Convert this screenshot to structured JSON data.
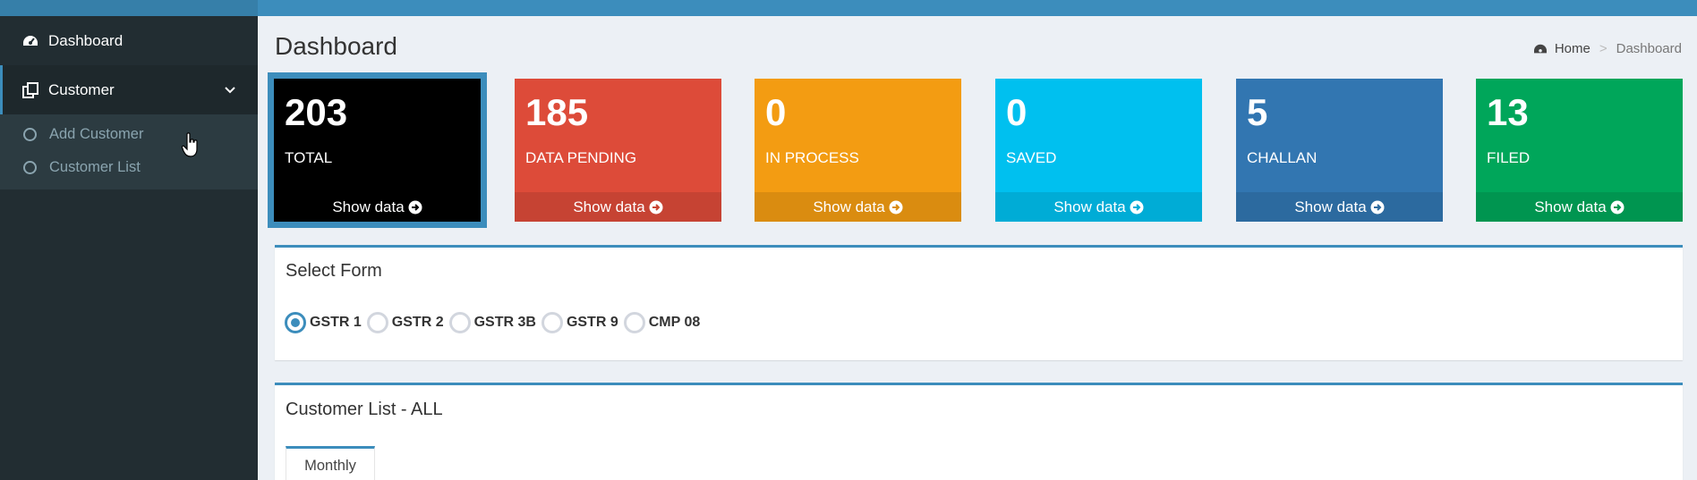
{
  "sidebar": {
    "items": [
      {
        "label": "Dashboard",
        "icon": "dashboard-icon"
      },
      {
        "label": "Customer",
        "icon": "customer-icon",
        "expanded": true,
        "children": [
          {
            "label": "Add Customer"
          },
          {
            "label": "Customer List"
          }
        ]
      }
    ]
  },
  "header": {
    "title": "Dashboard",
    "breadcrumb": {
      "home": "Home",
      "separator": ">",
      "current": "Dashboard"
    }
  },
  "stats": [
    {
      "value": "203",
      "label": "TOTAL",
      "link": "Show data",
      "color": "#000000",
      "selected": true
    },
    {
      "value": "185",
      "label": "DATA PENDING",
      "link": "Show data",
      "color": "#dd4b39"
    },
    {
      "value": "0",
      "label": "IN PROCESS",
      "link": "Show data",
      "color": "#f39c12"
    },
    {
      "value": "0",
      "label": "SAVED",
      "link": "Show data",
      "color": "#00c0ef"
    },
    {
      "value": "5",
      "label": "CHALLAN",
      "link": "Show data",
      "color": "#3276b1"
    },
    {
      "value": "13",
      "label": "FILED",
      "link": "Show data",
      "color": "#00a65a"
    }
  ],
  "select_form": {
    "title": "Select Form",
    "options": [
      "GSTR 1",
      "GSTR 2",
      "GSTR 3B",
      "GSTR 9",
      "CMP 08"
    ],
    "selected": "GSTR 1"
  },
  "customer_list": {
    "title": "Customer List - ALL",
    "tabs": [
      {
        "label": "Monthly",
        "active": true
      }
    ]
  },
  "colors": {
    "accent": "#3c8dbc",
    "sidebar": "#222d32"
  }
}
